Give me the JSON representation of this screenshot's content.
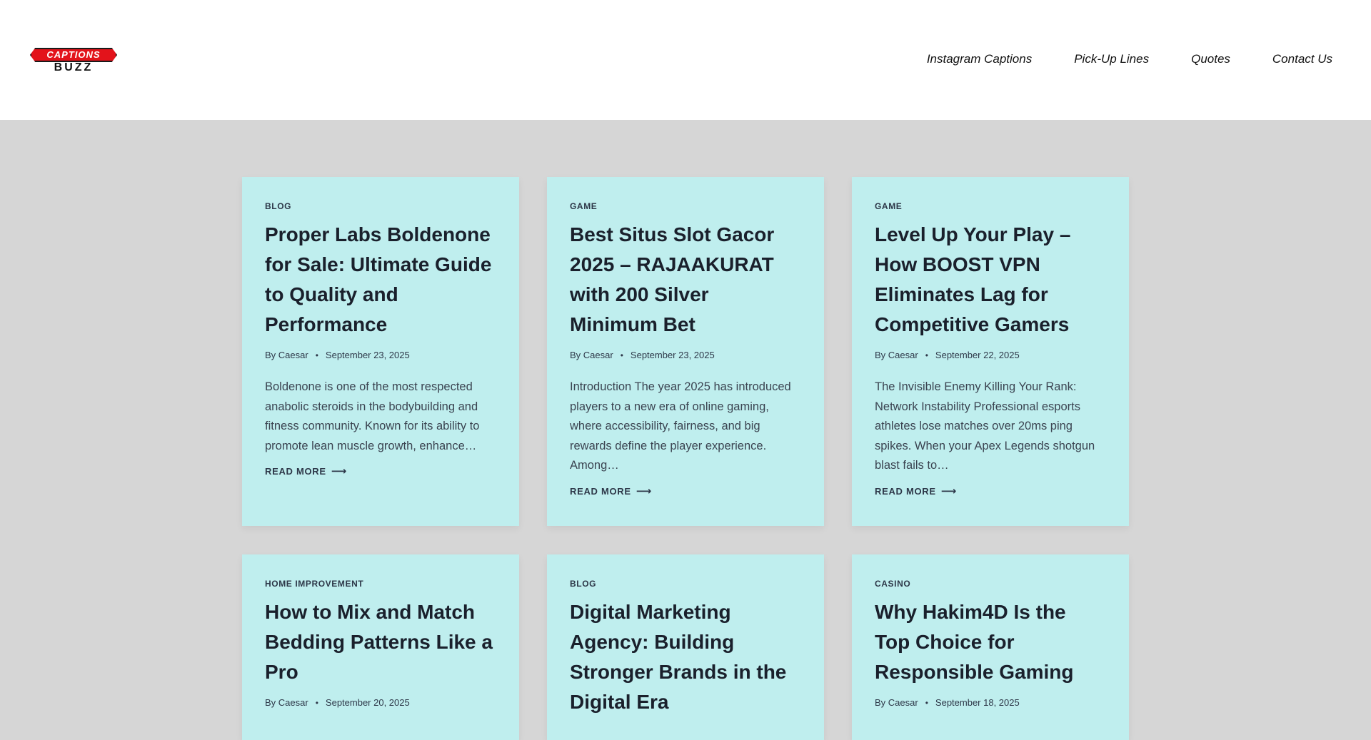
{
  "header": {
    "logo_top": "CAPTIONS",
    "logo_bottom": "BUZZ",
    "nav": [
      "Instagram Captions",
      "Pick-Up Lines",
      "Quotes",
      "Contact Us"
    ]
  },
  "posts": [
    {
      "category": "BLOG",
      "title": "Proper Labs Boldenone for Sale: Ultimate Guide to Quality and Performance",
      "by": "By",
      "author": "Caesar",
      "date": "September 23, 2025",
      "excerpt": "Boldenone is one of the most respected anabolic steroids in the bodybuilding and fitness community. Known for its ability to promote lean muscle growth, enhance…",
      "read_more": "READ MORE"
    },
    {
      "category": "GAME",
      "title": "Best Situs Slot Gacor 2025 – RAJAAKURAT with 200 Silver Minimum Bet",
      "by": "By",
      "author": "Caesar",
      "date": "September 23, 2025",
      "excerpt": "Introduction The year 2025 has introduced players to a new era of online gaming, where accessibility, fairness, and big rewards define the player experience. Among…",
      "read_more": "READ MORE"
    },
    {
      "category": "GAME",
      "title": "Level Up Your Play – How BOOST VPN Eliminates Lag for Competitive Gamers",
      "by": "By",
      "author": "Caesar",
      "date": "September 22, 2025",
      "excerpt": "The Invisible Enemy Killing Your Rank: Network Instability Professional esports athletes lose matches over 20ms ping spikes. When your Apex Legends shotgun blast fails to…",
      "read_more": "READ MORE"
    },
    {
      "category": "HOME IMPROVEMENT",
      "title": "How to Mix and Match Bedding Patterns Like a Pro",
      "by": "By",
      "author": "Caesar",
      "date": "September 20, 2025"
    },
    {
      "category": "BLOG",
      "title": "Digital Marketing Agency: Building Stronger Brands in the Digital Era"
    },
    {
      "category": "CASINO",
      "title": "Why Hakim4D Is the Top Choice for Responsible Gaming",
      "by": "By",
      "author": "Caesar",
      "date": "September 18, 2025"
    }
  ]
}
